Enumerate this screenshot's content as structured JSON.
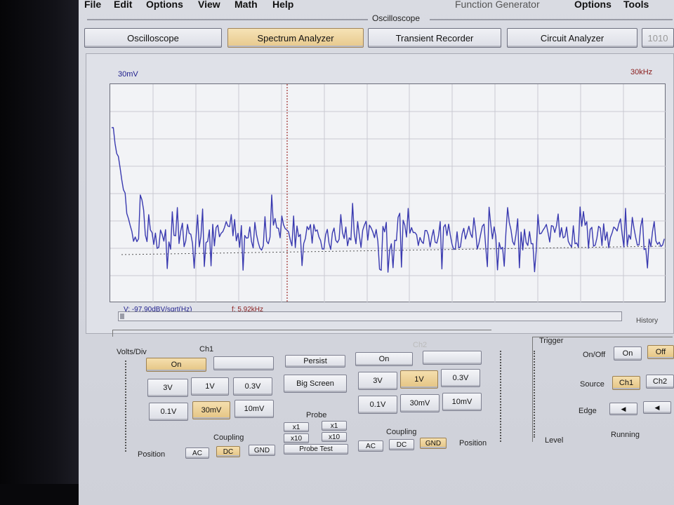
{
  "menu": {
    "left": [
      "File",
      "Edit",
      "Options",
      "View",
      "Math",
      "Help"
    ],
    "right": [
      "Function Generator",
      "Options",
      "Tools"
    ]
  },
  "group_title": "Oscilloscope",
  "tabs": [
    {
      "label": "Oscilloscope",
      "active": false
    },
    {
      "label": "Spectrum Analyzer",
      "active": true
    },
    {
      "label": "Transient Recorder",
      "active": false
    },
    {
      "label": "Circuit Analyzer",
      "active": false
    },
    {
      "label": "1010",
      "active": false
    }
  ],
  "plot": {
    "y_scale_label": "30mV",
    "x_scale_label": "30kHz",
    "readout_v": "V: -97.90dBV/sqrt(Hz)",
    "readout_f": "f: 5.92kHz",
    "trace_color": "#3a3ab0",
    "cursor_color": "#a03030"
  },
  "history_label": "History",
  "volts_div_label": "Volts/Div",
  "ch1": {
    "label": "Ch1",
    "on_label": "On",
    "ranges": [
      "3V",
      "1V",
      "0.3V",
      "0.1V",
      "30mV",
      "10mV"
    ],
    "selected_range": "30mV",
    "coupling_label": "Coupling",
    "coupling": [
      "AC",
      "DC",
      "GND"
    ],
    "selected_coupling": "DC",
    "position_label": "Position"
  },
  "persist_label": "Persist",
  "big_screen_label": "Big Screen",
  "probe": {
    "label": "Probe",
    "x1": "x1",
    "x10": "x10",
    "test_label": "Probe Test"
  },
  "ch2": {
    "label": "Ch2",
    "on_label": "On",
    "ranges": [
      "3V",
      "1V",
      "0.3V",
      "0.1V",
      "30mV",
      "10mV"
    ],
    "selected_range": "1V",
    "coupling_label": "Coupling",
    "coupling": [
      "AC",
      "DC",
      "GND"
    ],
    "selected_coupling": "GND",
    "position_label": "Position"
  },
  "trigger": {
    "label": "Trigger",
    "onoff_label": "On/Off",
    "on": "On",
    "off": "Off",
    "selected_onoff": "Off",
    "source_label": "Source",
    "sources": [
      "Ch1",
      "Ch2"
    ],
    "selected_source": "Ch1",
    "edge_label": "Edge",
    "level_label": "Level",
    "status": "Running"
  },
  "colors": {
    "selected": "#e4c483",
    "accent_blue": "#1d1d8c",
    "accent_red": "#8a1d1d"
  },
  "icons": {
    "edge_rising": "triangle-left-icon",
    "edge_falling": "triangle-left-icon"
  }
}
